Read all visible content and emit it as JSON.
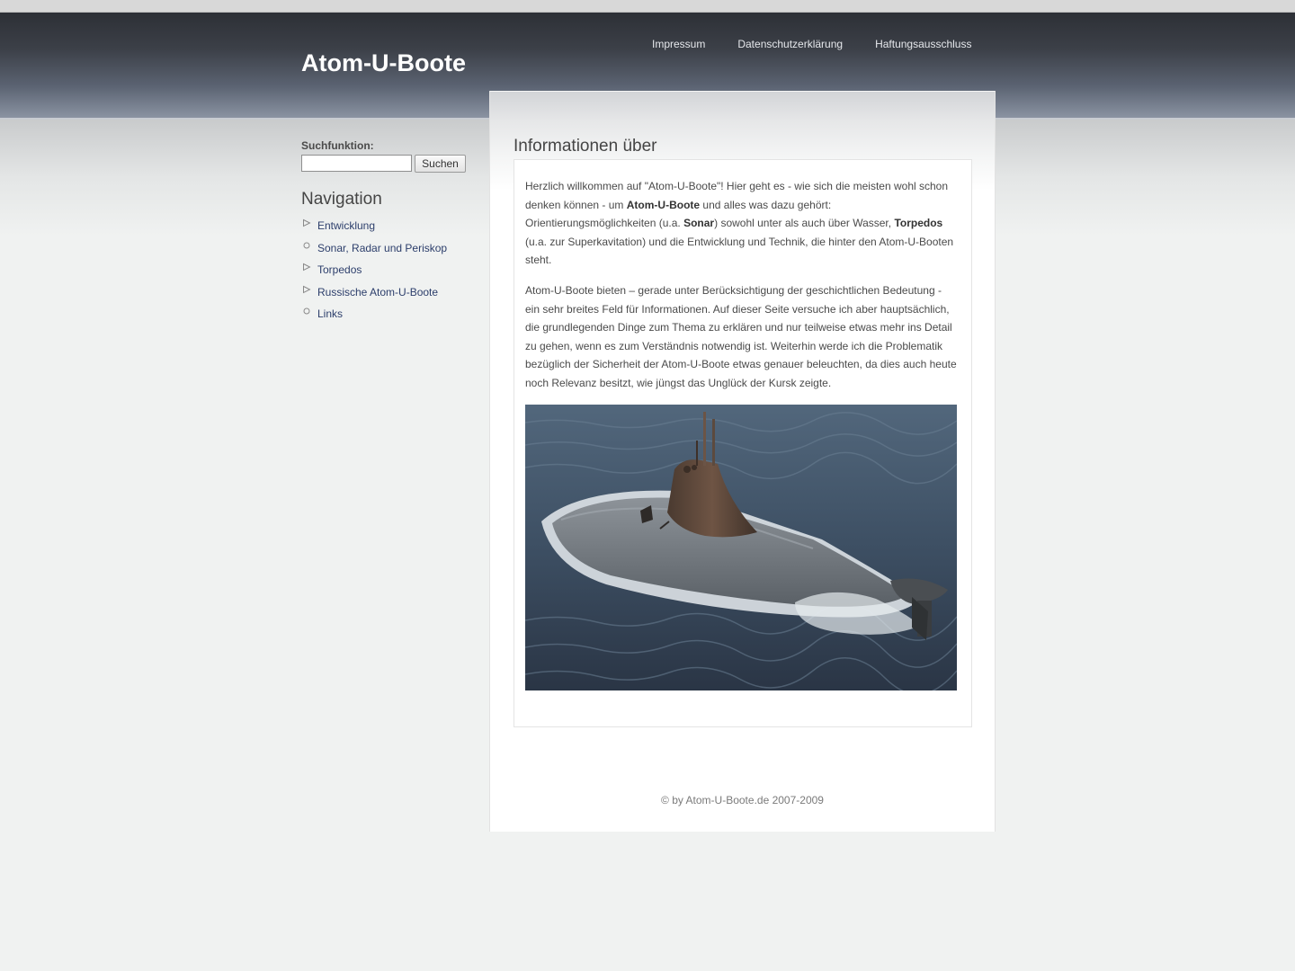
{
  "site": {
    "title": "Atom-U-Boote"
  },
  "topnav": [
    {
      "label": "Impressum"
    },
    {
      "label": "Datenschutzerklärung"
    },
    {
      "label": "Haftungsausschluss"
    }
  ],
  "sidebar": {
    "search_label": "Suchfunktion:",
    "search_value": "",
    "search_button": "Suchen",
    "nav_title": "Navigation",
    "nav_items": [
      {
        "label": "Entwicklung",
        "icon": "triangle-bullet-icon"
      },
      {
        "label": "Sonar, Radar und Periskop",
        "icon": "circle-bullet-icon"
      },
      {
        "label": "Torpedos",
        "icon": "triangle-bullet-icon"
      },
      {
        "label": "Russische Atom-U-Boote",
        "icon": "triangle-bullet-icon"
      },
      {
        "label": "Links",
        "icon": "circle-bullet-icon"
      }
    ]
  },
  "main": {
    "title": "Informationen über",
    "p1": {
      "s1": "Herzlich willkommen auf \"Atom-U-Boote\"! Hier geht es - wie sich die meisten wohl schon denken können - um ",
      "b1": "Atom-U-Boote",
      "s2": " und alles was dazu gehört: Orientierungsmöglichkeiten (u.a. ",
      "b2": "Sonar",
      "s3": ") sowohl unter als auch über Wasser, ",
      "b3": "Torpedos",
      "s4": " (u.a. zur Superkavitation) und die Entwicklung und Technik, die hinter den Atom-U-Booten steht."
    },
    "p2": "Atom-U-Boote bieten – gerade unter Berücksichtigung der geschichtlichen Bedeutung - ein sehr breites Feld für Informationen. Auf dieser Seite versuche ich aber hauptsächlich, die grundlegenden Dinge zum Thema zu erklären und nur teilweise etwas mehr ins Detail zu gehen, wenn es zum Verständnis notwendig ist. Weiterhin werde ich die Problematik bezüglich der Sicherheit der Atom-U-Boote etwas genauer beleuchten, da dies auch heute noch Relevanz besitzt, wie jüngst das Unglück der Kursk zeigte.",
    "footer": "© by Atom-U-Boote.de 2007-2009"
  },
  "colors": {
    "header_dark": "#2d3036",
    "link": "#2c3e6b",
    "water": "#3d4f63",
    "hull": "#767c82",
    "sail": "#5e4638"
  }
}
